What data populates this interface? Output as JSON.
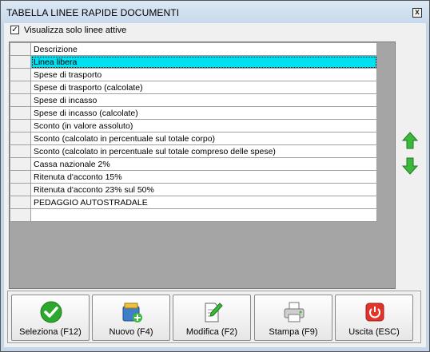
{
  "window": {
    "title": "TABELLA LINEE RAPIDE DOCUMENTI",
    "close_glyph": "x"
  },
  "filter": {
    "checkbox_checked": true,
    "checkbox_mark": "✓",
    "label": "Visualizza solo linee attive"
  },
  "grid": {
    "column_header": "Descrizione",
    "selected_index": 0,
    "rows": [
      "Linea libera",
      "Spese di trasporto",
      "Spese di trasporto (calcolate)",
      "Spese di incasso",
      "Spese di incasso (calcolate)",
      "Sconto (in valore assoluto)",
      "Sconto (calcolato in percentuale sul totale corpo)",
      "Sconto (calcolato in percentuale sul totale compreso delle spese)",
      "Cassa nazionale 2%",
      "Ritenuta d'acconto 15%",
      "Ritenuta d'acconto 23% sul 50%",
      "PEDAGGIO AUTOSTRADALE",
      ""
    ]
  },
  "toolbar": {
    "select_label": "Seleziona (F12)",
    "new_label": "Nuovo (F4)",
    "edit_label": "Modifica (F2)",
    "print_label": "Stampa (F9)",
    "exit_label": "Uscita (ESC)"
  },
  "colors": {
    "selection": "#00e0f0",
    "arrow_green": "#3cb83c",
    "select_icon": "#2da82d",
    "exit_icon": "#e0352b"
  }
}
